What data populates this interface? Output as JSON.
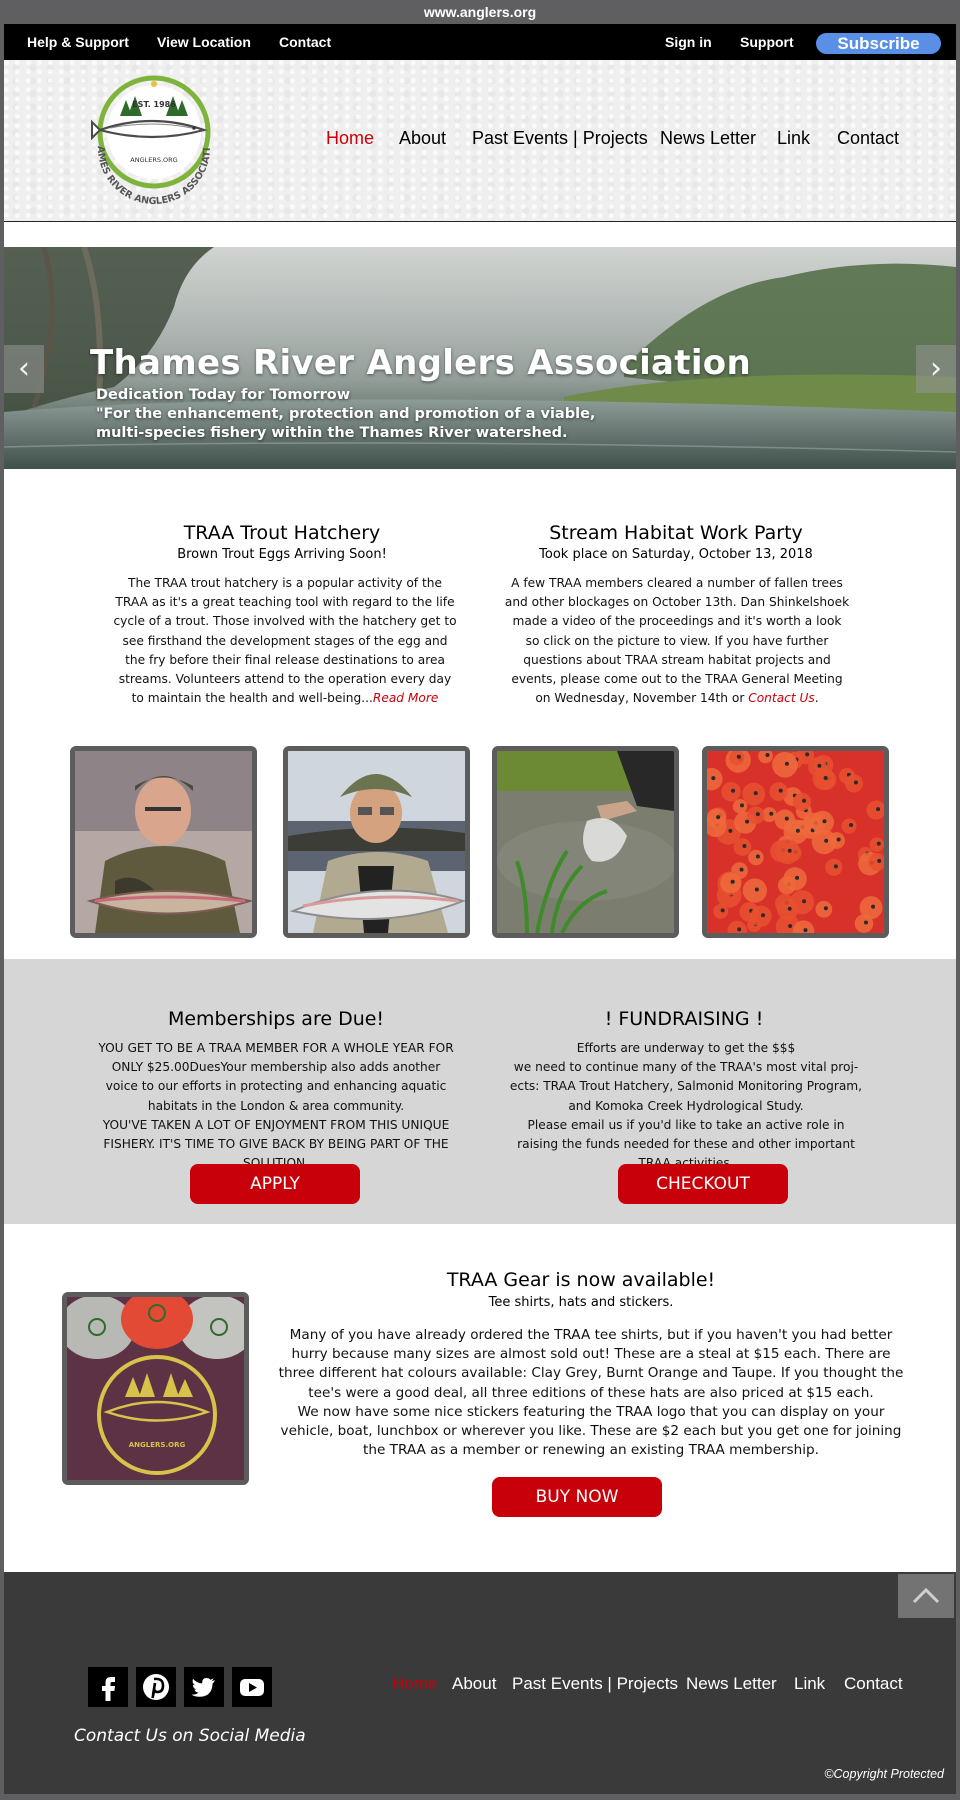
{
  "browser": {
    "url": "www.anglers.org"
  },
  "topbar": {
    "help_support": "Help & Support",
    "view_location": "View Location",
    "contact": "Contact",
    "sign_in": "Sign in",
    "support": "Support",
    "subscribe": "Subscribe"
  },
  "logo": {
    "est": "EST. 1986",
    "site": "ANGLERS.ORG",
    "ring_text": "THAMES RIVER ANGLERS ASSOCIATION"
  },
  "nav": {
    "items": [
      {
        "label": "Home",
        "active": true
      },
      {
        "label": "About"
      },
      {
        "label": "Past Events | Projects"
      },
      {
        "label": "News Letter"
      },
      {
        "label": "Link"
      },
      {
        "label": "Contact"
      }
    ]
  },
  "hero": {
    "title": "Thames River Anglers Association",
    "line1": "Dedication Today for Tomorrow",
    "line2": "\"For the enhancement, protection and promotion of a viable,",
    "line3": "multi-species fishery within the Thames River watershed.",
    "prev_arrow": "‹",
    "next_arrow": "›"
  },
  "news": [
    {
      "title": "TRAA Trout Hatchery",
      "subtitle": "Brown Trout Eggs Arriving Soon!",
      "body": "The TRAA trout hatchery is a popular activity of the TRAA as it's a great teaching tool with regard to the life cycle of a trout. Those involved with the hatchery get to see firsthand the development stages of the egg and the fry before their final release destinations to area streams. Volunteers attend to the operation every day to maintain the health and well-being...",
      "link": "Read More"
    },
    {
      "title": "Stream Habitat Work Party",
      "subtitle": "Took place on Saturday, October 13, 2018",
      "body": "A few TRAA members cleared a number of fallen trees and other blockages on October 13th. Dan Shinkelshoek made a video of the proceedings and it's worth a look so click on the picture to view. If you have further questions about TRAA stream habitat projects and events, please come out to the TRAA General Meeting on Wednesday, November 14th or ",
      "link": "Contact Us",
      "tail": "."
    }
  ],
  "memberships": {
    "title": "Memberships are Due!",
    "body": "YOU GET TO BE A TRAA MEMBER FOR A WHOLE YEAR FOR ONLY $25.00DuesYour membership also adds another voice to our efforts in protecting and enhancing aquatic habitats in the London & area community.",
    "body2": "YOU'VE TAKEN A LOT OF ENJOYMENT FROM THIS UNIQUE FISHERY. IT'S TIME TO GIVE BACK BY BEING PART OF THE SOLUTION.",
    "button": "APPLY"
  },
  "fundraising": {
    "title": "! FUNDRAISING !",
    "body": "Efforts are underway to get the $$$",
    "body2": "we need to continue many of the TRAA's most vital proj-ects: TRAA Trout Hatchery, Salmonid Monitoring Program, and Komoka Creek Hydrological Study.",
    "body3": "Please email us if you'd like to take an active role in raising the funds needed for these and other important TRAA activities.",
    "button": "CHECKOUT"
  },
  "gear": {
    "title": "TRAA Gear is now available!",
    "subtitle": "Tee shirts, hats and stickers.",
    "body": "Many of you have already ordered the TRAA tee shirts, but if you haven't you had better hurry because many sizes are almost sold out! These are a steal at $15 each. There are three different hat colours available: Clay Grey, Burnt Orange and Taupe. If you thought the tee's were a good deal, all three editions of these hats are also priced at $15 each.",
    "body2": "We now have some nice stickers featuring the TRAA logo that you can display on your vehicle, boat, lunchbox or wherever you like. These are $2 each but you get one for joining the TRAA as a member or renewing an existing TRAA membership.",
    "button": "BUY NOW"
  },
  "footer": {
    "contact_social": "Contact Us on Social Media",
    "copyright": "©Copyright Protected"
  },
  "colors": {
    "accent_red": "#c8000a",
    "subscribe_blue": "#5a8fe6",
    "footer_bg": "#3a3a3a",
    "band_bg": "#d6d6d6"
  }
}
